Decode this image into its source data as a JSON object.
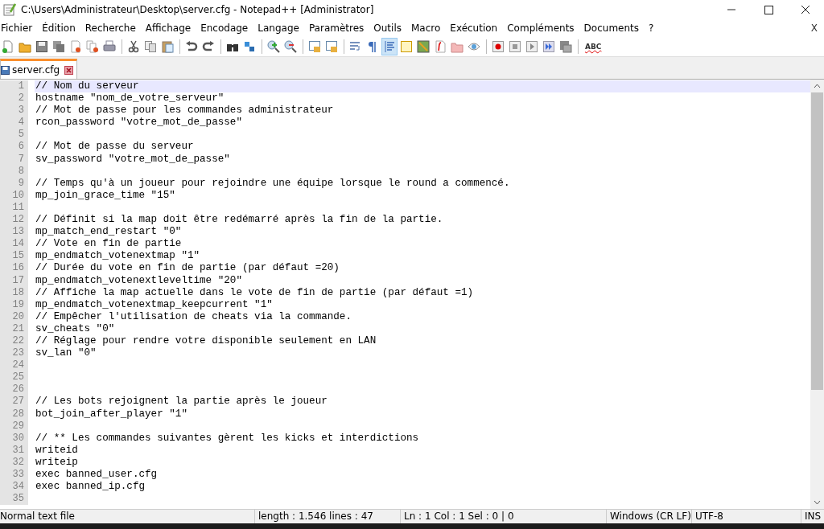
{
  "window": {
    "title": "C:\\Users\\Administrateur\\Desktop\\server.cfg - Notepad++ [Administrator]"
  },
  "menu": [
    "Fichier",
    "Édition",
    "Recherche",
    "Affichage",
    "Encodage",
    "Langage",
    "Paramètres",
    "Outils",
    "Macro",
    "Exécution",
    "Compléments",
    "Documents",
    "?"
  ],
  "menu_close": "X",
  "toolbar": {
    "indent_guide": {
      "on": true
    },
    "spellcheck_label": "ABC"
  },
  "tabs": [
    {
      "label": "server.cfg",
      "selected": true
    }
  ],
  "editor": {
    "lines": [
      {
        "number": "1",
        "text": "// Nom du serveur",
        "selected": true
      },
      {
        "number": "2",
        "text": "hostname \"nom_de_votre_serveur\"",
        "selected": false
      },
      {
        "number": "3",
        "text": "// Mot de passe pour les commandes administrateur",
        "selected": false
      },
      {
        "number": "4",
        "text": "rcon_password \"votre_mot_de_passe\"",
        "selected": false
      },
      {
        "number": "5",
        "selected": false
      },
      {
        "number": "6",
        "text": "// Mot de passe du serveur",
        "selected": false
      },
      {
        "number": "7",
        "text": "sv_password \"votre_mot_de_passe\"",
        "selected": false
      },
      {
        "number": "8",
        "selected": false
      },
      {
        "number": "9",
        "text": "// Temps qu'à un joueur pour rejoindre une équipe lorsque le round a commencé.",
        "selected": false
      },
      {
        "number": "10",
        "text": "mp_join_grace_time \"15\"",
        "selected": false
      },
      {
        "number": "11",
        "selected": false
      },
      {
        "number": "12",
        "text": "// Définit si la map doit être redémarré après la fin de la partie.",
        "selected": false
      },
      {
        "number": "13",
        "text": "mp_match_end_restart \"0\"",
        "selected": false
      },
      {
        "number": "14",
        "text": "// Vote en fin de partie",
        "selected": false
      },
      {
        "number": "15",
        "text": "mp_endmatch_votenextmap \"1\"",
        "selected": false
      },
      {
        "number": "16",
        "text": "// Durée du vote en fin de partie (par défaut =20)",
        "selected": false
      },
      {
        "number": "17",
        "text": "mp_endmatch_votenextleveltime \"20\"",
        "selected": false
      },
      {
        "number": "18",
        "text": "// Affiche la map actuelle dans le vote de fin de partie (par défaut =1)",
        "selected": false
      },
      {
        "number": "19",
        "text": "mp_endmatch_votenextmap_keepcurrent \"1\"",
        "selected": false
      },
      {
        "number": "20",
        "text": "// Empêcher l'utilisation de cheats via la commande.",
        "selected": false
      },
      {
        "number": "21",
        "text": "sv_cheats \"0\"",
        "selected": false
      },
      {
        "number": "22",
        "text": "// Réglage pour rendre votre disponible seulement en LAN",
        "selected": false
      },
      {
        "number": "23",
        "text": "sv_lan \"0\"",
        "selected": false
      },
      {
        "number": "24",
        "selected": false
      },
      {
        "number": "25",
        "selected": false
      },
      {
        "number": "26",
        "selected": false
      },
      {
        "number": "27",
        "text": "// Les bots rejoignent la partie après le joueur",
        "selected": false
      },
      {
        "number": "28",
        "text": "bot_join_after_player \"1\"",
        "selected": false
      },
      {
        "number": "29",
        "selected": false
      },
      {
        "number": "30",
        "text": "// ** Les commandes suivantes gèrent les kicks et interdictions",
        "selected": false
      },
      {
        "number": "31",
        "text": "writeid",
        "selected": false
      },
      {
        "number": "32",
        "text": "writeip",
        "selected": false
      },
      {
        "number": "33",
        "text": "exec banned_user.cfg",
        "selected": false
      },
      {
        "number": "34",
        "text": "exec banned_ip.cfg",
        "selected": false
      },
      {
        "number": "35",
        "selected": false
      }
    ]
  },
  "status_bar": [
    "Normal text file",
    "length : 1.546    lines : 47",
    "Ln : 1    Col : 1    Sel : 0 | 0",
    "Windows (CR LF)",
    "UTF-8",
    "INS"
  ]
}
